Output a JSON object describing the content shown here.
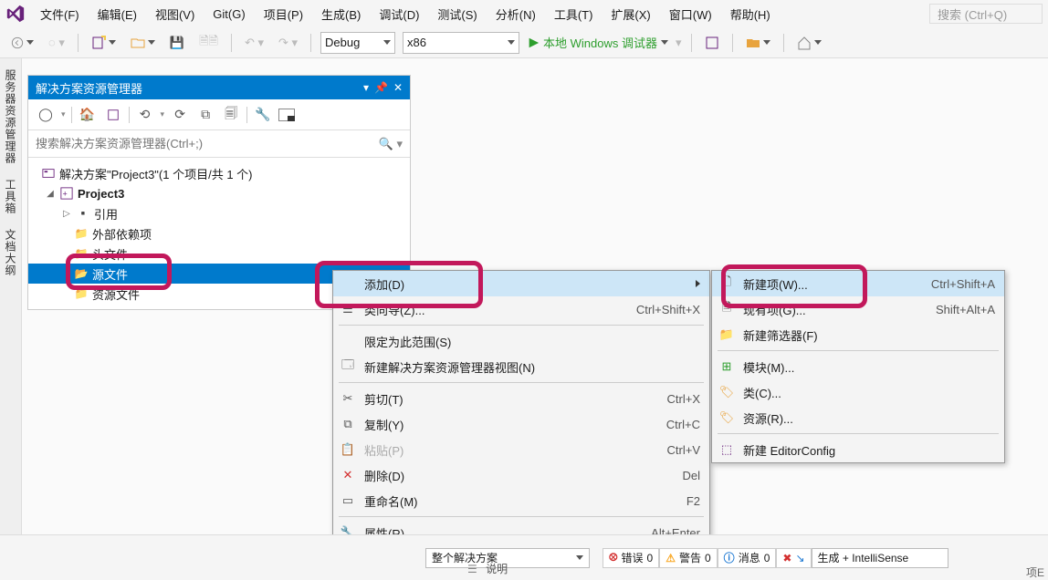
{
  "menubar": {
    "items": [
      "文件(F)",
      "编辑(E)",
      "视图(V)",
      "Git(G)",
      "项目(P)",
      "生成(B)",
      "调试(D)",
      "测试(S)",
      "分析(N)",
      "工具(T)",
      "扩展(X)",
      "窗口(W)",
      "帮助(H)"
    ],
    "search_placeholder": "搜索 (Ctrl+Q)"
  },
  "toolbar": {
    "config": "Debug",
    "platform": "x86",
    "run_label": "本地 Windows 调试器"
  },
  "left_tabs": [
    "服务器资源管理器",
    "工具箱",
    "文档大纲"
  ],
  "solution_explorer": {
    "title": "解决方案资源管理器",
    "search_placeholder": "搜索解决方案资源管理器(Ctrl+;)",
    "root_label": "解决方案\"Project3\"(1 个项目/共 1 个)",
    "project_label": "Project3",
    "nodes": {
      "refs": "引用",
      "ext_deps": "外部依赖项",
      "headers": "头文件",
      "sources": "源文件",
      "resources": "资源文件"
    }
  },
  "context_menu_1": {
    "add": "添加(D)",
    "class_wizard": "类向导(Z)...",
    "class_wizard_sc": "Ctrl+Shift+X",
    "scope": "限定为此范围(S)",
    "new_view": "新建解决方案资源管理器视图(N)",
    "cut": "剪切(T)",
    "cut_sc": "Ctrl+X",
    "copy": "复制(Y)",
    "copy_sc": "Ctrl+C",
    "paste": "粘贴(P)",
    "paste_sc": "Ctrl+V",
    "delete": "删除(D)",
    "delete_sc": "Del",
    "rename": "重命名(M)",
    "rename_sc": "F2",
    "properties": "属性(R)",
    "properties_sc": "Alt+Enter"
  },
  "context_menu_2": {
    "new_item": "新建项(W)...",
    "new_item_sc": "Ctrl+Shift+A",
    "existing_item": "现有项(G)...",
    "existing_item_sc": "Shift+Alt+A",
    "new_filter": "新建筛选器(F)",
    "module": "模块(M)...",
    "class": "类(C)...",
    "resource": "资源(R)...",
    "editorconfig": "新建 EditorConfig"
  },
  "status_bar": {
    "scope_select": "整个解决方案",
    "errors_label": "错误",
    "errors_count": "0",
    "warnings_label": "警告",
    "warnings_count": "0",
    "messages_label": "消息",
    "messages_count": "0",
    "build_intellisense": "生成 + IntelliSense",
    "desc_label": "说明",
    "corner": "项E"
  },
  "colors": {
    "accent": "#007acc",
    "highlight": "#c2185b"
  }
}
